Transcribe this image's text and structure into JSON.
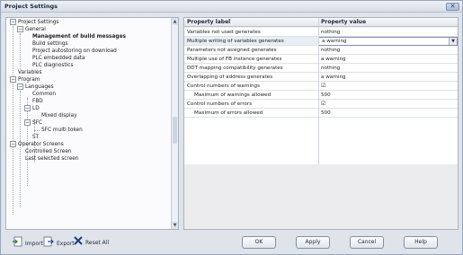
{
  "window": {
    "title": "Project Settings"
  },
  "tree": {
    "root": "Project Settings",
    "general": "General",
    "management": "Management of build messages",
    "build_settings": "Build settings",
    "project_autostore": "Project autostoring on download",
    "plc_embedded": "PLC embedded data",
    "plc_diagnostics": "PLC diagnostics",
    "variables": "Variables",
    "program": "Program",
    "languages": "Languages",
    "common": "Common",
    "fbd": "FBD",
    "ld": "LD",
    "mixed_display": "Mixed display",
    "sfc": "SFC",
    "sfc_multitoken": "SFC multi token",
    "st": "ST",
    "operator_screens": "Operator Screens",
    "controlled_screen": "Controlled Screen",
    "last_selected_screen": "Last selected screen"
  },
  "grid": {
    "header_label": "Property label",
    "header_value": "Property value",
    "rows": [
      {
        "label": "Variables not used generates",
        "value": "nothing"
      },
      {
        "label": "Multiple writing of variables generates",
        "value": "a warning"
      },
      {
        "label": "Parameters not assigned generates",
        "value": "nothing"
      },
      {
        "label": "Multiple use of FB instance generates",
        "value": "a warning"
      },
      {
        "label": "DDT mapping compatibility generates",
        "value": "nothing"
      },
      {
        "label": "Overlapping of address generates",
        "value": "a warning"
      },
      {
        "label": "Control numbers of warnings",
        "value": "☑"
      },
      {
        "label": "Maximum of warnings allowed",
        "value": "500"
      },
      {
        "label": "Control numbers of errors",
        "value": "☑"
      },
      {
        "label": "Maximum of errors allowed",
        "value": "500"
      }
    ]
  },
  "buttons": {
    "import": "Import",
    "export": "Export",
    "reset_all": "Reset All",
    "ok": "OK",
    "apply": "Apply",
    "cancel": "Cancel",
    "help": "Help"
  },
  "icons": {
    "import": "import-icon",
    "export": "export-icon",
    "reset_all": "reset-all-icon",
    "close": "close-icon"
  },
  "colors": {
    "title_bar": "#d7dde6",
    "panel_border": "#a9b3c1",
    "selected_row": "#e9edf5",
    "reset_icon": "#1f3f7a"
  }
}
